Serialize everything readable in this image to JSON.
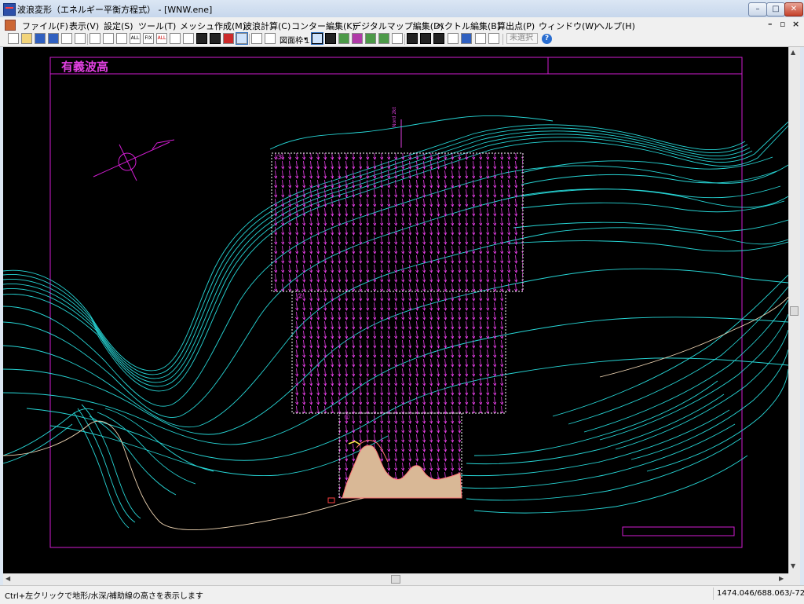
{
  "window": {
    "title": "波浪変形（エネルギー平衡方程式） - [WNW.ene]",
    "minimize": "–",
    "maximize": "□",
    "close": "✕"
  },
  "menu": {
    "items": [
      "ファイル(F)",
      "表示(V)",
      "設定(S)",
      "ツール(T)",
      "メッシュ作成(M)",
      "波浪計算(C)",
      "コンター編集(K)",
      "デジタルマップ編集(D)",
      "ベクトル編集(B)",
      "算出点(P)",
      "ウィンドウ(W)",
      "ヘルプ(H)"
    ],
    "mdi_minimize": "–",
    "mdi_restore": "▫",
    "mdi_close": "×"
  },
  "toolbar": {
    "frame_select": "図面枠１",
    "mode_combo": "未選択",
    "help": "?",
    "icon_labels": {
      "all1": "ALL",
      "fix": "FIX",
      "all2": "ALL"
    }
  },
  "drawing": {
    "title": "有義波高",
    "north_label": "Nord 2kt",
    "area_labels": [
      "③",
      "②",
      "①"
    ]
  },
  "colors": {
    "frame": "#d21dd2",
    "contour": "#27d6d6",
    "mesh_vector": "#e83ee8",
    "land": "#d9b896",
    "coast": "#ff7272",
    "background": "#000000"
  },
  "status": {
    "message": "Ctrl+左クリックで地形/水深/補助線の高さを表示します",
    "coords": "1474.046/688.063/-72.8"
  }
}
